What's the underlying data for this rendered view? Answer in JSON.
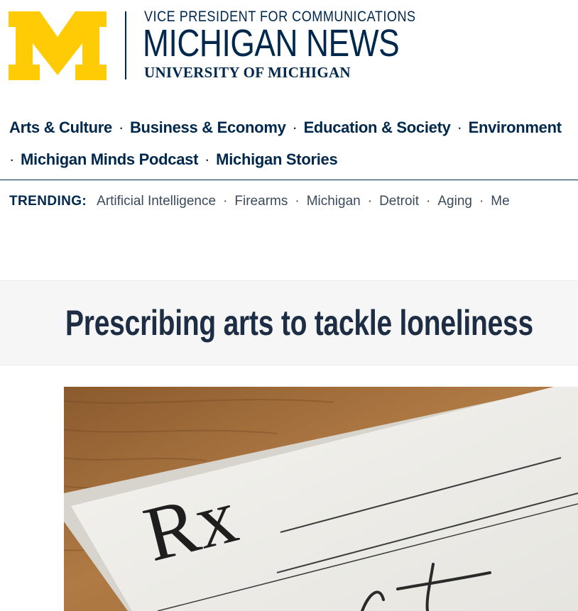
{
  "header": {
    "kicker": "VICE PRESIDENT FOR COMMUNICATIONS",
    "brand": "MICHIGAN NEWS",
    "university": "UNIVERSITY OF MICHIGAN",
    "logo_color": "#ffcb05",
    "brand_color": "#00274c"
  },
  "nav": {
    "row1": [
      "Arts & Culture",
      "Business & Economy",
      "Education & Society",
      "Environment"
    ],
    "row2": [
      "Michigan Minds Podcast",
      "Michigan Stories"
    ],
    "separator": "·"
  },
  "trending": {
    "label": "TRENDING:",
    "items": [
      "Artificial Intelligence",
      "Firearms",
      "Michigan",
      "Detroit",
      "Aging",
      "Me"
    ]
  },
  "article": {
    "title": "Prescribing arts to tackle loneliness",
    "hero_icon": "prescription-pad-image",
    "hero_text": "Rx"
  }
}
